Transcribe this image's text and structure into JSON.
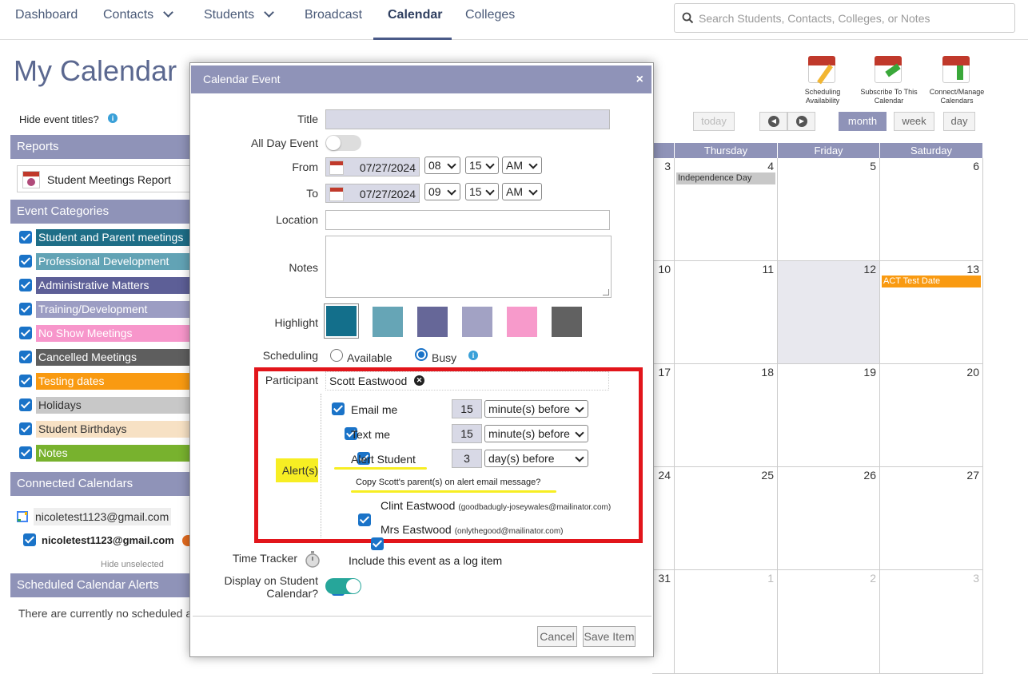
{
  "nav": {
    "items": [
      {
        "label": "Dashboard"
      },
      {
        "label": "Contacts"
      },
      {
        "label": "Students"
      },
      {
        "label": "Broadcast"
      },
      {
        "label": "Calendar"
      },
      {
        "label": "Colleges"
      }
    ],
    "search_placeholder": "Search Students, Contacts, Colleges, or Notes"
  },
  "page": {
    "title": "My Calendar",
    "hide_titles": "Hide event titles?"
  },
  "tools": [
    {
      "label": "Scheduling Availability"
    },
    {
      "label": "Subscribe To This Calendar"
    },
    {
      "label": "Connect/Manage Calendars"
    }
  ],
  "sidebar": {
    "reports_head": "Reports",
    "report_item": "Student Meetings Report",
    "categories_head": "Event Categories",
    "categories": [
      {
        "label": "Student and Parent meetings",
        "color": "#1e6e87"
      },
      {
        "label": "Professional Development",
        "color": "#62a3b5"
      },
      {
        "label": "Administrative Matters",
        "color": "#5d5f97"
      },
      {
        "label": "Training/Development",
        "color": "#9c9dc3"
      },
      {
        "label": "No Show Meetings",
        "color": "#f796cb"
      },
      {
        "label": "Cancelled Meetings",
        "color": "#5e5e5e"
      },
      {
        "label": "Testing dates",
        "color": "#f99a11"
      },
      {
        "label": "Holidays",
        "color": "#c8c8c8"
      },
      {
        "label": "Student Birthdays",
        "color": "#f7e1c4"
      },
      {
        "label": "Notes",
        "color": "#78b22e"
      }
    ],
    "connected_head": "Connected Calendars",
    "connected_account": "nicoletest1123@gmail.com",
    "connected_item": "nicoletest1123@gmail.com",
    "hide_unselected": "Hide unselected",
    "alerts_head": "Scheduled Calendar Alerts",
    "alerts_text": "There are currently no scheduled a"
  },
  "calendar": {
    "buttons": {
      "today": "today",
      "month": "month",
      "week": "week",
      "day": "day"
    },
    "days": [
      "Thursday",
      "Friday",
      "Saturday"
    ],
    "weeks": [
      [
        "3",
        "4",
        "5",
        "6"
      ],
      [
        "10",
        "11",
        "12",
        "13"
      ],
      [
        "17",
        "18",
        "19",
        "20"
      ],
      [
        "24",
        "25",
        "26",
        "27"
      ],
      [
        "31",
        "1",
        "2",
        "3"
      ]
    ],
    "events": {
      "independence": "Independence Day",
      "act": "ACT Test Date"
    }
  },
  "modal": {
    "title": "Calendar Event",
    "close": "×",
    "labels": {
      "title": "Title",
      "all_day": "All Day Event",
      "from": "From",
      "to": "To",
      "location": "Location",
      "notes": "Notes",
      "highlight": "Highlight",
      "scheduling": "Scheduling",
      "participant": "Participant",
      "alerts": "Alert(s)",
      "time_tracker": "Time Tracker",
      "display_on": "Display on Student",
      "display_on2": "Calendar?"
    },
    "from": {
      "date": "07/27/2024",
      "hour": "08",
      "minute": "15",
      "ampm": "AM"
    },
    "to": {
      "date": "07/27/2024",
      "hour": "09",
      "minute": "15",
      "ampm": "AM"
    },
    "highlight_colors": [
      "#136f8b",
      "#66a5b6",
      "#666798",
      "#a2a2c4",
      "#f79acb",
      "#616161"
    ],
    "scheduling": {
      "available": "Available",
      "busy": "Busy"
    },
    "participant": "Scott Eastwood",
    "alerts": [
      {
        "label": "Email me",
        "amount": "15",
        "unit": "minute(s) before"
      },
      {
        "label": "Text me",
        "amount": "15",
        "unit": "minute(s) before"
      },
      {
        "label": "Alert Student",
        "amount": "3",
        "unit": "day(s) before"
      }
    ],
    "copy_parents": "Copy Scott's parent(s) on alert email message?",
    "parents": [
      {
        "name": "Clint Eastwood",
        "email": "(goodbadugly-joseywales@mailinator.com)"
      },
      {
        "name": "Mrs Eastwood",
        "email": "(onlythegood@mailinator.com)"
      }
    ],
    "log_item": "Include this event as a log item",
    "cancel": "Cancel",
    "save": "Save Item"
  }
}
